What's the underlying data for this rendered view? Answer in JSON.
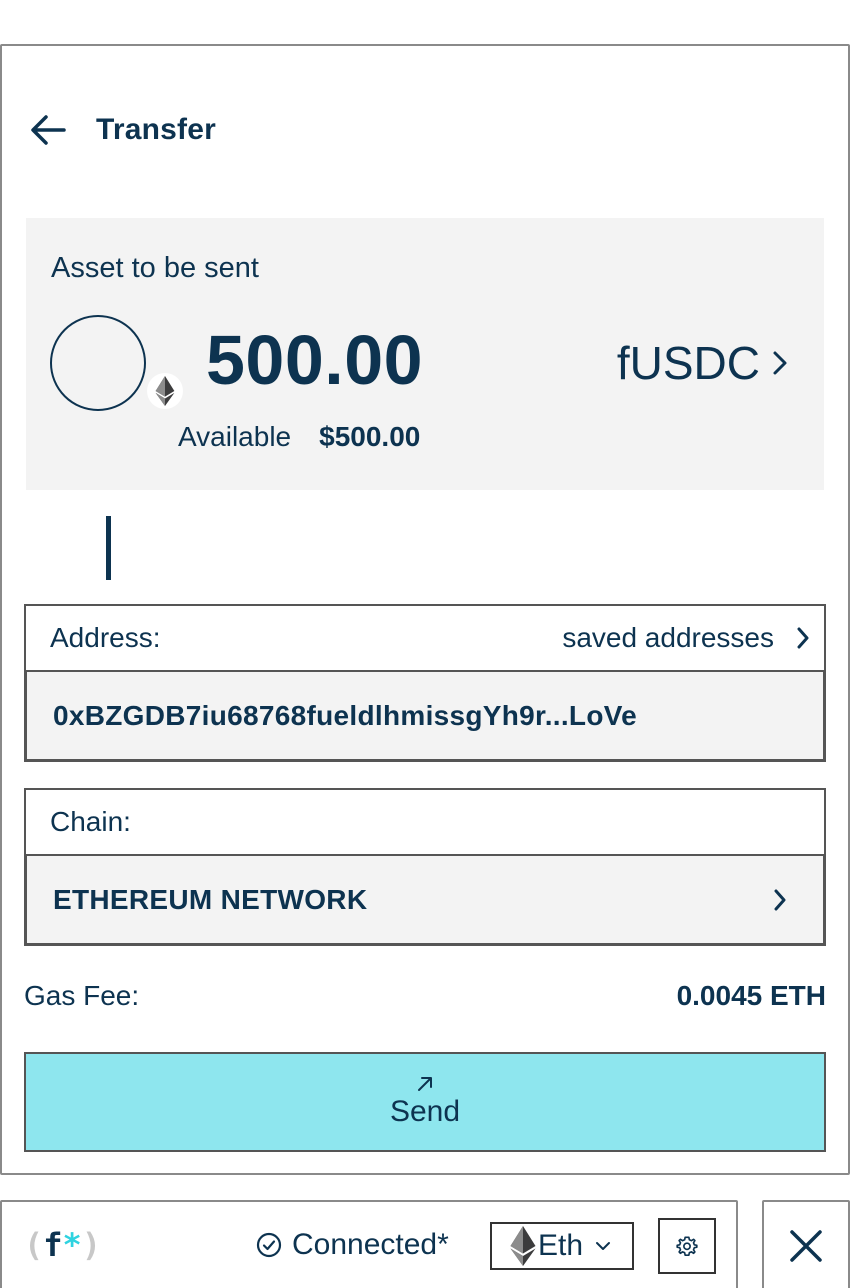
{
  "header": {
    "title": "Transfer"
  },
  "asset": {
    "label": "Asset to be sent",
    "amount": "500.00",
    "token": "fUSDC",
    "available_label": "Available",
    "available_value": "$500.00"
  },
  "address": {
    "label": "Address:",
    "saved_link": "saved addresses",
    "value": "0xBZGDB7iu68768fueldlhmissgYh9r...LoVe"
  },
  "chain": {
    "label": "Chain:",
    "value": "ETHEREUM NETWORK"
  },
  "gas": {
    "label": "Gas Fee:",
    "value": "0.0045 ETH"
  },
  "send": {
    "label": "Send"
  },
  "footer": {
    "logo_open": "(",
    "logo_f": "f",
    "logo_star": "*",
    "logo_close": ")",
    "status": "Connected*",
    "chain_short": "Eth"
  },
  "colors": {
    "primary": "#0d3350",
    "accent": "#8ee6ee",
    "card_bg": "#f3f3f3",
    "logo_star": "#2fd3e0"
  },
  "icons": [
    "back-arrow-icon",
    "ethereum-icon",
    "chevron-right-icon",
    "arrow-up-right-icon",
    "check-circle-icon",
    "chevron-down-icon",
    "gear-icon",
    "close-icon"
  ]
}
